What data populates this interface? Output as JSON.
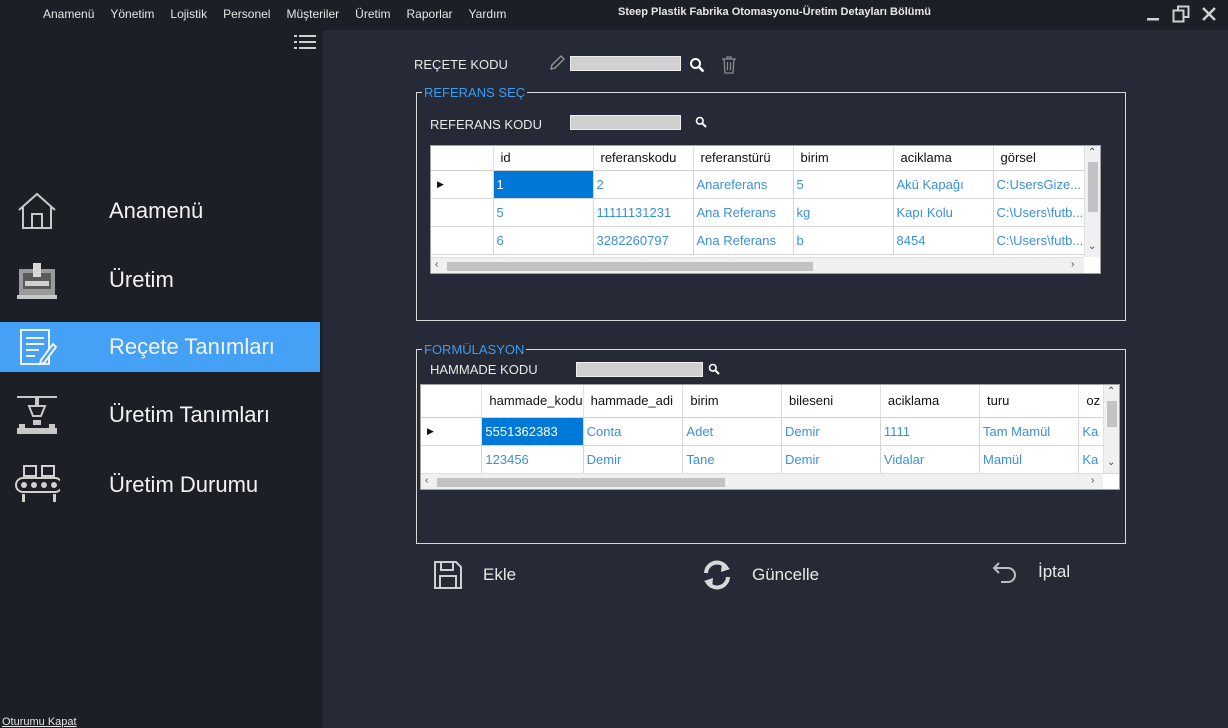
{
  "menu": [
    "Anamenü",
    "Yönetim",
    "Lojistik",
    "Personel",
    "Müşteriler",
    "Üretim",
    "Raporlar",
    "Yardım"
  ],
  "app_title": "Steep Plastik Fabrika Otomasyonu-Üretim Detayları Bölümü",
  "sidebar": {
    "items": [
      {
        "label": "Anamenü",
        "icon": "home-icon"
      },
      {
        "label": "Üretim",
        "icon": "machine-icon"
      },
      {
        "label": "Reçete Tanımları",
        "icon": "recipe-icon",
        "active": true
      },
      {
        "label": "Üretim Tanımları",
        "icon": "robot-arm-icon"
      },
      {
        "label": "Üretim Durumu",
        "icon": "conveyor-icon"
      }
    ],
    "logout": "Oturumu Kapat"
  },
  "recipe": {
    "label": "REÇETE KODU",
    "value": ""
  },
  "referans": {
    "group_title": "REFERANS SEÇ",
    "code_label": "REFERANS KODU",
    "code_value": "",
    "columns": [
      "id",
      "referanskodu",
      "referanstürü",
      "birim",
      "aciklama",
      "görsel"
    ],
    "rows": [
      [
        "1",
        "2",
        "Anareferans",
        "5",
        "Akü Kapağı",
        "C:UsersGize..."
      ],
      [
        "5",
        "11111131231",
        "Ana Referans",
        "kg",
        "Kapı Kolu",
        "C:\\Users\\futb..."
      ],
      [
        "6",
        "3282260797",
        "Ana Referans",
        "b",
        "8454",
        "C:\\Users\\futb..."
      ]
    ]
  },
  "formulasyon": {
    "group_title": "FORMÜLASYON",
    "code_label": "HAMMADE KODU",
    "code_value": "",
    "columns": [
      "hammade_kodu",
      "hammade_adi",
      "birim",
      "bileseni",
      "aciklama",
      "turu",
      "oz"
    ],
    "rows": [
      [
        "5551362383",
        "Conta",
        "Adet",
        "Demir",
        "1111",
        "Tam Mamül",
        "Ka"
      ],
      [
        "123456",
        "Demir",
        "Tane",
        "Demir",
        "Vidalar",
        "Mamül",
        "Ka"
      ]
    ]
  },
  "actions": {
    "add": "Ekle",
    "update": "Güncelle",
    "cancel": "İptal"
  },
  "colors": {
    "accent": "#44a1f5",
    "selection": "#0078d7",
    "cell_text": "#3d8fd9",
    "background": "#262a36",
    "sidebar": "#1d1f27"
  }
}
